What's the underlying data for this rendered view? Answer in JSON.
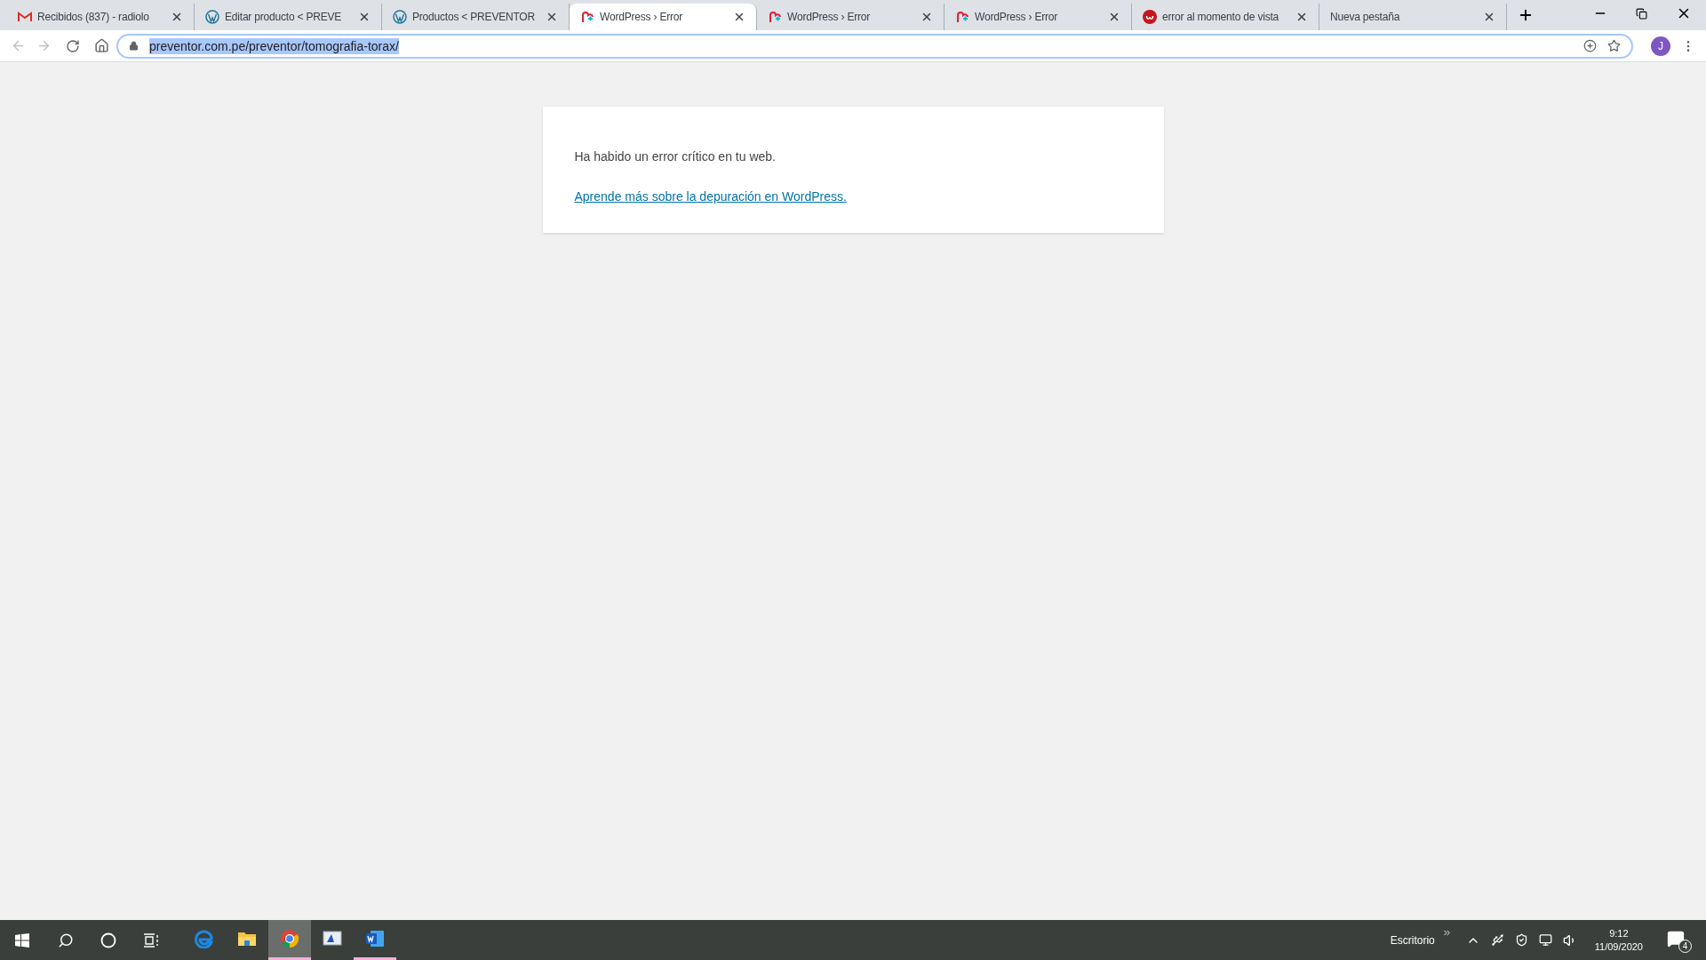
{
  "tabs": [
    {
      "kind": "gmail",
      "label": "Recibidos (837) - radiolo",
      "selected": false
    },
    {
      "kind": "wordpress",
      "label": "Editar producto < PREVE",
      "selected": false
    },
    {
      "kind": "wordpress",
      "label": "Productos < PREVENTOR",
      "selected": false
    },
    {
      "kind": "error",
      "label": "WordPress › Error",
      "selected": true
    },
    {
      "kind": "error",
      "label": "WordPress › Error",
      "selected": false
    },
    {
      "kind": "error",
      "label": "WordPress › Error",
      "selected": false
    },
    {
      "kind": "site",
      "label": "error al momento de vista",
      "selected": false
    },
    {
      "kind": "blank",
      "label": "Nueva pestaña",
      "selected": false
    }
  ],
  "address_bar": {
    "url": "preventor.com.pe/preventor/tomografia-torax/"
  },
  "profile": {
    "initial": "J"
  },
  "page": {
    "message": "Ha habido un error crítico en tu web.",
    "link": "Aprende más sobre la depuración en WordPress."
  },
  "taskbar": {
    "apps": [
      {
        "kind": "edge",
        "running": false,
        "selected": false
      },
      {
        "kind": "explorer",
        "running": false,
        "selected": false
      },
      {
        "kind": "chrome",
        "running": true,
        "selected": true
      },
      {
        "kind": "monitor",
        "running": false,
        "selected": false
      },
      {
        "kind": "word",
        "running": true,
        "selected": false
      }
    ],
    "toolbar_label": "Escritorio",
    "time": "9:12",
    "date": "11/09/2020",
    "notifications": "4"
  }
}
